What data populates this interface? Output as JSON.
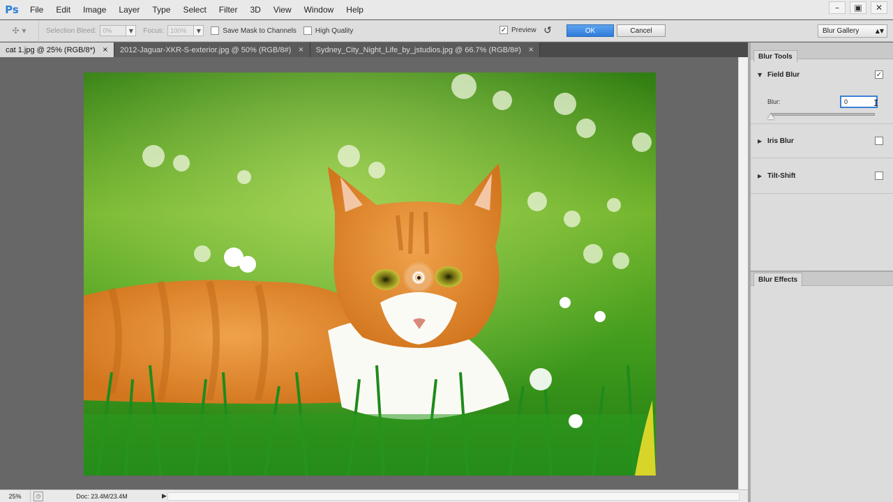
{
  "app": {
    "logo": "Ps",
    "menu": [
      "File",
      "Edit",
      "Image",
      "Layer",
      "Type",
      "Select",
      "Filter",
      "3D",
      "View",
      "Window",
      "Help"
    ],
    "window_controls": [
      "–",
      "▣",
      "✕"
    ]
  },
  "options": {
    "selection_bleed_label": "Selection Bleed:",
    "selection_bleed_value": "0%",
    "focus_label": "Focus:",
    "focus_value": "100%",
    "save_mask_label": "Save Mask to Channels",
    "high_quality_label": "High Quality",
    "preview_label": "Preview",
    "preview_checked": "✓",
    "ok_label": "OK",
    "cancel_label": "Cancel",
    "gallery_label": "Blur Gallery"
  },
  "tabs": [
    {
      "label": "cat 1.jpg @ 25% (RGB/8*)",
      "close": "×"
    },
    {
      "label": "2012-Jaguar-XKR-S-exterior.jpg @ 50% (RGB/8#)",
      "close": "×"
    },
    {
      "label": "Sydney_City_Night_Life_by_jstudios.jpg @ 66.7% (RGB/8#)",
      "close": "×"
    }
  ],
  "status": {
    "zoom": "25%",
    "doc": "Doc: 23.4M/23.4M",
    "play": "▶"
  },
  "panel": {
    "blur_tools_tab": "Blur Tools",
    "field_blur": {
      "label": "Field Blur",
      "checked": "✓",
      "expanded": "▼"
    },
    "blur_label": "Blur:",
    "blur_value": "0",
    "iris_blur": {
      "label": "Iris Blur",
      "expanded": "▶"
    },
    "tilt_shift": {
      "label": "Tilt-Shift",
      "expanded": "▶"
    },
    "blur_effects_tab": "Blur Effects",
    "collapse_icon": "▸▸"
  }
}
